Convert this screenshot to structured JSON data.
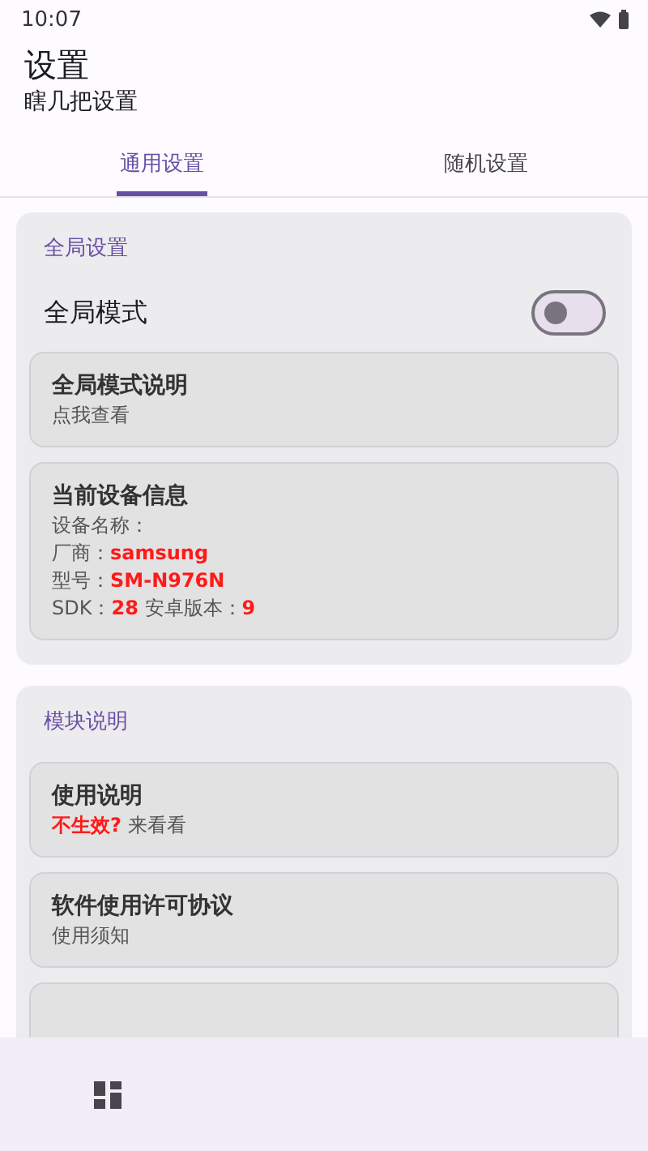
{
  "status_bar": {
    "time": "10:07"
  },
  "header": {
    "title": "设置",
    "subtitle": "瞎几把设置"
  },
  "tabs": [
    {
      "label": "通用设置",
      "selected": true
    },
    {
      "label": "随机设置",
      "selected": false
    }
  ],
  "sections": [
    {
      "title": "全局设置",
      "items": [
        {
          "kind": "toggle",
          "label": "全局模式",
          "on": false
        },
        {
          "kind": "card",
          "title": "全局模式说明",
          "lines": [
            "点我查看"
          ]
        },
        {
          "kind": "card",
          "title": "当前设备信息",
          "lines": [
            "设备名称：",
            "厂商：**samsung**",
            "型号：**SM-N976N**",
            "SDK：**28** 安卓版本：**9**"
          ]
        }
      ]
    },
    {
      "title": "模块说明",
      "items": [
        {
          "kind": "card",
          "title": "使用说明",
          "lines": [
            "**不生效?** 来看看"
          ]
        },
        {
          "kind": "card",
          "title": "软件使用许可协议",
          "lines": [
            "使用须知"
          ]
        },
        {
          "kind": "card"
        }
      ]
    }
  ]
}
